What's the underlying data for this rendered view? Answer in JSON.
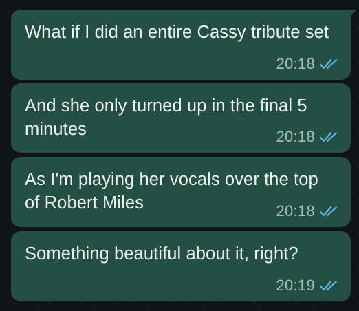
{
  "chat": {
    "messages": [
      {
        "text": "What if I did an entire Cassy tribute set",
        "time": "20:18",
        "status": "read"
      },
      {
        "text": "And she only turned up in the final 5 minutes",
        "time": "20:18",
        "status": "read"
      },
      {
        "text": "As I'm playing her vocals over the top of Robert Miles",
        "time": "20:18",
        "status": "read"
      },
      {
        "text": "Something beautiful about it, right?",
        "time": "20:19",
        "status": "read"
      }
    ]
  },
  "colors": {
    "bubble": "#245043",
    "background": "#0e1418",
    "tick_read": "#5fb7e8",
    "time": "#a8bdb6"
  },
  "icons": {
    "read_receipt": "double-check-icon"
  }
}
